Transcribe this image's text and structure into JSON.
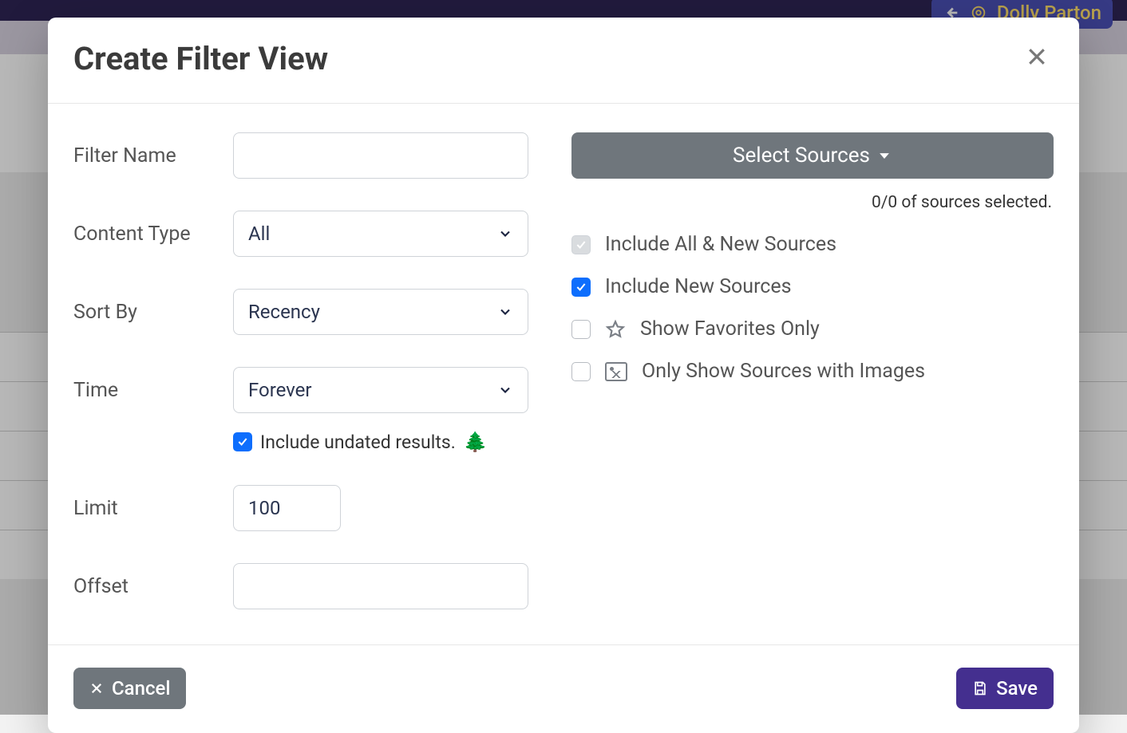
{
  "header": {
    "user_name": "Dolly Parton"
  },
  "modal": {
    "title": "Create Filter View",
    "labels": {
      "filter_name": "Filter Name",
      "content_type": "Content Type",
      "sort_by": "Sort By",
      "time": "Time",
      "limit": "Limit",
      "offset": "Offset"
    },
    "values": {
      "filter_name": "",
      "content_type": "All",
      "sort_by": "Recency",
      "time": "Forever",
      "limit": "100",
      "offset": ""
    },
    "include_undated": {
      "checked": true,
      "label": "Include undated results.",
      "emoji": "🌲"
    },
    "right": {
      "select_sources": "Select Sources",
      "count_text": "0/0 of sources selected.",
      "opt_all_new": {
        "checked": false,
        "disabled": true,
        "label": "Include All & New Sources"
      },
      "opt_new": {
        "checked": true,
        "label": "Include New Sources"
      },
      "opt_fav": {
        "checked": false,
        "label": "Show Favorites Only"
      },
      "opt_img": {
        "checked": false,
        "label": "Only Show Sources with Images"
      }
    },
    "buttons": {
      "cancel": "Cancel",
      "save": "Save"
    }
  }
}
